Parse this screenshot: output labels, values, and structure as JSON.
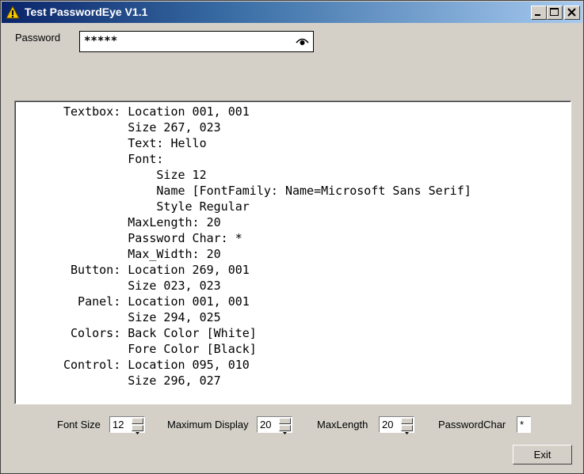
{
  "window": {
    "title": "Test PasswordEye V1.1",
    "title_icon": "warning-icon"
  },
  "password": {
    "label": "Password",
    "masked_value": "*****",
    "toggle_icon": "eye-icon"
  },
  "output": {
    "lines": [
      "Textbox: Location 001, 001",
      "         Size 267, 023",
      "         Text: Hello",
      "         Font:",
      "             Size 12",
      "             Name [FontFamily: Name=Microsoft Sans Serif]",
      "             Style Regular",
      "         MaxLength: 20",
      "         Password Char: *",
      "         Max_Width: 20",
      " Button: Location 269, 001",
      "         Size 023, 023",
      "  Panel: Location 001, 001",
      "         Size 294, 025",
      " Colors: Back Color [White]",
      "         Fore Color [Black]",
      "Control: Location 095, 010",
      "         Size 296, 027"
    ]
  },
  "controls": {
    "font_size": {
      "label": "Font Size",
      "value": "12"
    },
    "maximum_display": {
      "label": "Maximum Display",
      "value": "20"
    },
    "max_length": {
      "label": "MaxLength",
      "value": "20"
    },
    "password_char": {
      "label": "PasswordChar",
      "value": "*"
    }
  },
  "buttons": {
    "exit_label": "Exit"
  }
}
